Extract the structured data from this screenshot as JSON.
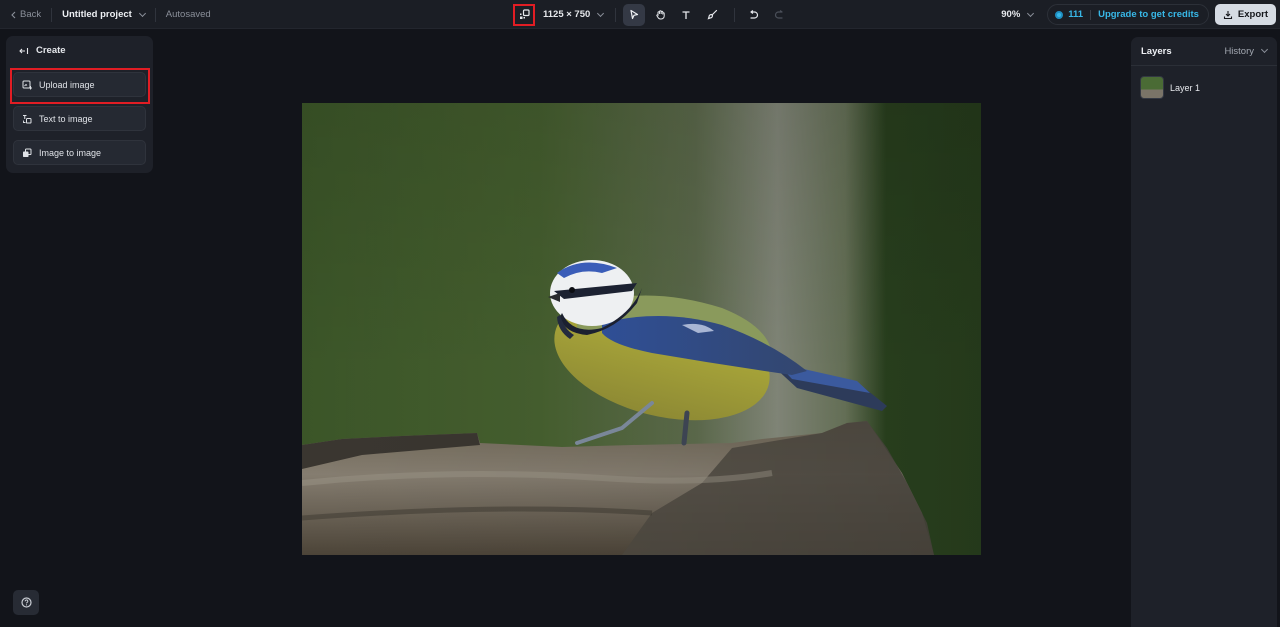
{
  "topbar": {
    "back_label": "Back",
    "project_name": "Untitled project",
    "save_status": "Autosaved",
    "canvas_size": "1125 × 750",
    "zoom_level": "90%",
    "credits_count": "111",
    "upgrade_label": "Upgrade to get credits",
    "export_label": "Export",
    "tools": [
      {
        "name": "select",
        "icon": "cursor-icon",
        "active": true
      },
      {
        "name": "hand",
        "icon": "hand-icon",
        "active": false
      },
      {
        "name": "text",
        "icon": "text-icon",
        "active": false
      },
      {
        "name": "brush",
        "icon": "brush-icon",
        "active": false
      },
      {
        "name": "undo",
        "icon": "undo-icon",
        "active": false
      },
      {
        "name": "redo",
        "icon": "redo-icon",
        "active": false
      }
    ]
  },
  "create_panel": {
    "title": "Create",
    "items": [
      {
        "label": "Upload image",
        "icon": "upload-image-icon"
      },
      {
        "label": "Text to image",
        "icon": "text-to-image-icon"
      },
      {
        "label": "Image to image",
        "icon": "image-to-image-icon"
      }
    ]
  },
  "layers_panel": {
    "title": "Layers",
    "history_label": "History",
    "layers": [
      {
        "name": "Layer 1"
      }
    ]
  },
  "canvas": {
    "image_description": "Blue tit perched on a mossy log against a green blurred background"
  },
  "colors": {
    "accent": "#38b8e8",
    "highlight": "#e11d24",
    "export_bg": "#d5dbe3"
  }
}
